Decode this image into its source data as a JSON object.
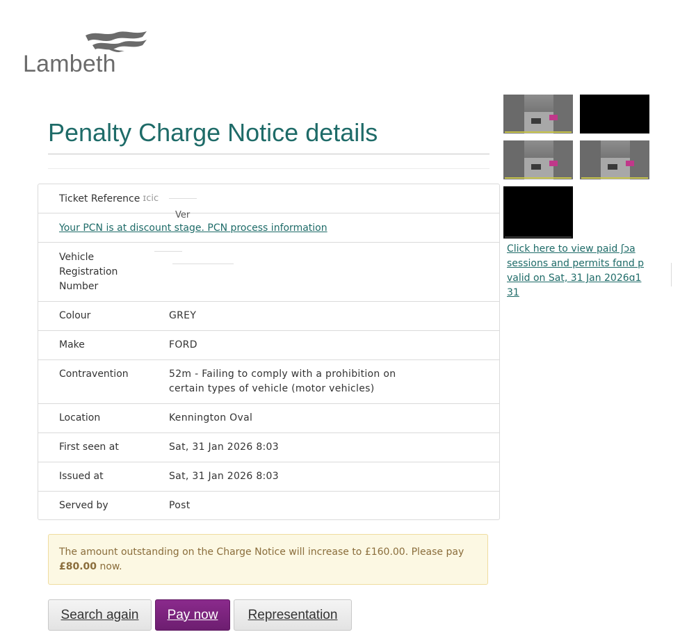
{
  "brand": {
    "name": "Lambeth"
  },
  "page": {
    "title": "Penalty Charge Notice details"
  },
  "details": {
    "ticket_reference_label": "Ticket Reference",
    "ticket_reference_value": "ɪcic",
    "ticket_reference_fragment": "Ver",
    "pcn_stage_link": "Your PCN is at discount stage. PCN process information",
    "vehicle_registration_label": "Vehicle Registration Number",
    "vehicle_registration_value": "",
    "rows": [
      {
        "label": "Colour",
        "value": "GREY"
      },
      {
        "label": "Make",
        "value": "FORD"
      },
      {
        "label": "Contravention",
        "value": "52m - Failing to comply with a prohibition on certain types of vehicle (motor vehicles)"
      },
      {
        "label": "Location",
        "value": "Kennington Oval"
      },
      {
        "label": "First seen at",
        "value": "Sat, 31 Jan 2026 8:03"
      },
      {
        "label": "Issued at",
        "value": "Sat, 31 Jan 2026 8:03"
      },
      {
        "label": "Served by",
        "value": "Post"
      }
    ]
  },
  "evidence": {
    "photos": [
      "street",
      "dark",
      "street",
      "street",
      "dark"
    ],
    "paid_sessions_link": "Click here to view paid ʃɔa sessions and permits fɑnd p valid on Sat, 31 Jan 2026ɑ1 31"
  },
  "notice": {
    "text_before": "The amount outstanding on the Charge Notice will increase to £160.00. Please pay",
    "amount": "£80.00",
    "text_after": "now."
  },
  "buttons": {
    "search_again": "Search again",
    "pay_now": "Pay now",
    "representation": "Representation"
  },
  "colors": {
    "title": "#1e6b68",
    "link": "#1e6b68",
    "primary_button": "#7b237e",
    "notice_background": "#fcf8e3",
    "notice_text": "#8a6d3b",
    "logo": "#6b6b6b"
  }
}
